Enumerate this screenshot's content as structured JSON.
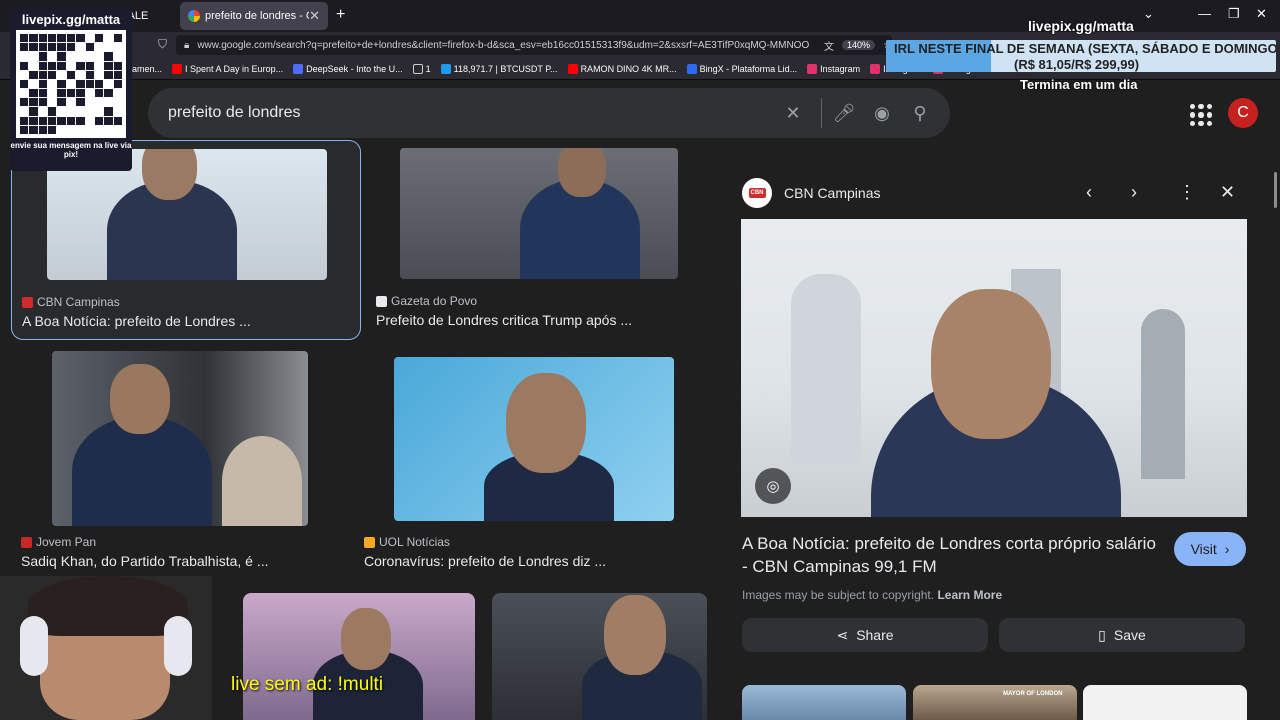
{
  "browser": {
    "tabs": [
      {
        "label": "U A ALE"
      },
      {
        "label": "prefeito de londres - Google S"
      }
    ],
    "url": "www.google.com/search?q=prefeito+de+londres&client=firefox-b-d&sca_esv=eb16cc01515313f9&udm=2&sxsrf=AE3TifP0xqMQ-MMNOO",
    "zoom": "140%",
    "bookmarks": [
      {
        "label": "amen..."
      },
      {
        "label": "I Spent A Day in Europ..."
      },
      {
        "label": "DeepSeek - Into the U..."
      },
      {
        "label": "1"
      },
      {
        "label": "118,971.7 | BTCUSDT P..."
      },
      {
        "label": "RAMON DINO 4K MR..."
      },
      {
        "label": "BingX - Plataforma Lid..."
      },
      {
        "label": "Instagram"
      },
      {
        "label": "Instagram"
      },
      {
        "label": "Instagram"
      }
    ]
  },
  "stream": {
    "qr_title": "livepix.gg/matta",
    "qr_caption": "envie sua mensagem na live via pix!",
    "top_title": "livepix.gg/matta",
    "banner_line1": "IRL NESTE FINAL DE SEMANA (SEXTA, SÁBADO E DOMINGO)",
    "banner_line2": "(R$ 81,05/R$ 299,99)",
    "banner_progress": 0.27,
    "banner_end": "Termina em um dia",
    "caption": "live sem ad: !multi"
  },
  "search": {
    "query": "prefeito de londres"
  },
  "results": [
    {
      "source": "CBN Campinas",
      "title": "A Boa Notícia: prefeito de Londres ...",
      "color": "#d12b2b"
    },
    {
      "source": "Gazeta do Povo",
      "title": "Prefeito de Londres critica Trump após ...",
      "color": "#e8eaed"
    },
    {
      "source": "Jovem Pan",
      "title": "Sadiq Khan, do Partido Trabalhista, é ...",
      "color": "#c62828"
    },
    {
      "source": "UOL Notícias",
      "title": "Coronavírus: prefeito de Londres diz ...",
      "color": "#f9a825"
    }
  ],
  "panel": {
    "source": "CBN Campinas",
    "logo": "CBN",
    "title": "A Boa Notícia: prefeito de Londres corta próprio salário - CBN Campinas 99,1 FM",
    "visit_label": "Visit",
    "copyright": "Images may be subject to copyright.",
    "learn_more": "Learn More",
    "share_label": "Share",
    "save_label": "Save",
    "related_badge": "MAYOR OF LONDON"
  },
  "colors": {
    "accent": "#8ab4f8",
    "avatar": "#c5221f"
  },
  "user": {
    "avatar_letter": "C"
  }
}
